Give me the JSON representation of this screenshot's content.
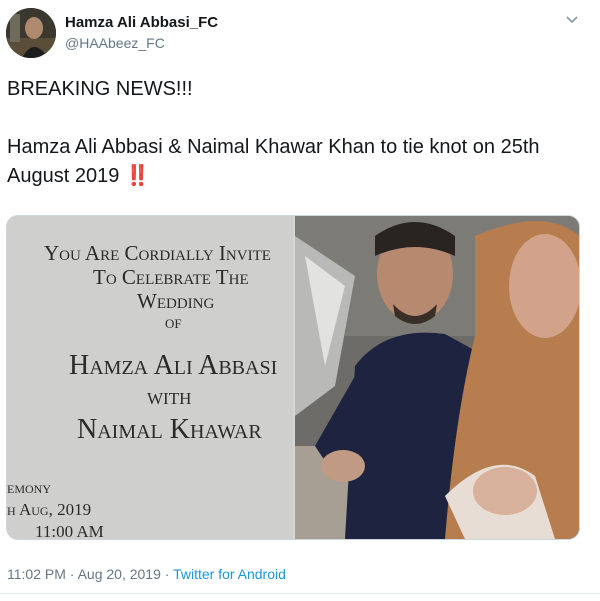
{
  "tweet": {
    "author_name": "Hamza Ali Abbasi_FC",
    "author_handle": "@HAAbeez_FC",
    "line1": "BREAKING NEWS!!!",
    "line2": "Hamza Ali Abbasi & Naimal Khawar Khan to tie knot on 25th August 2019",
    "emoji": "‼️",
    "time": "11:02 PM",
    "separator1": "·",
    "date": "Aug 20, 2019",
    "separator2": "·",
    "source": "Twitter for Android"
  },
  "card": {
    "l1": "You Are Cordially Invite",
    "l2": "To Celebrate The",
    "l3": "Wedding",
    "l4": "of",
    "l5": "Hamza Ali Abbasi",
    "l6": "with",
    "l7": "Naimal Khawar",
    "l8": "emony",
    "l9": "h Aug, 2019",
    "l10": "11:00 AM"
  },
  "colors": {
    "text": "#14171a",
    "muted": "#657786",
    "link": "#1b95e0",
    "emoji": "#d2152d"
  },
  "icons": {
    "menu": "chevron-down-icon"
  }
}
